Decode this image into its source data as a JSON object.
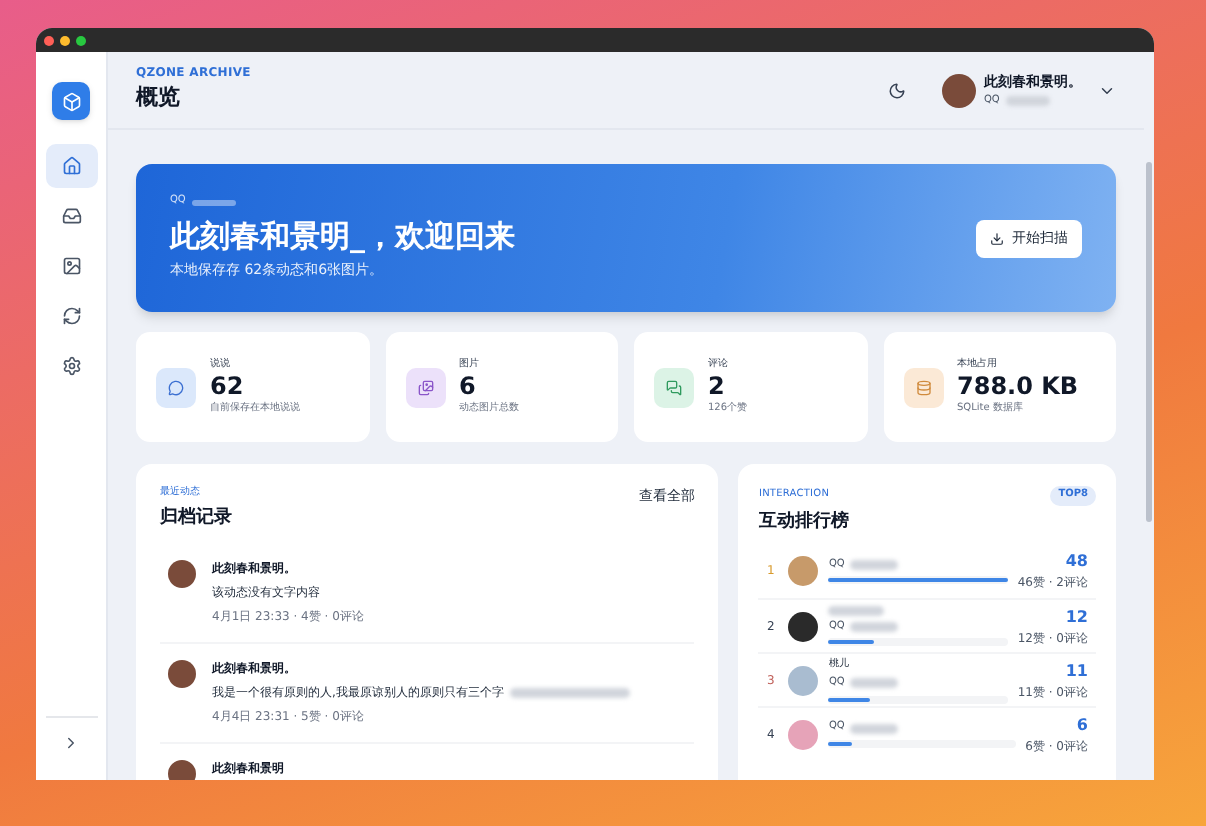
{
  "sidebar": {
    "items": [
      {
        "selected": true
      },
      {
        "selected": false
      },
      {
        "selected": false
      },
      {
        "selected": false
      },
      {
        "selected": false
      }
    ]
  },
  "header": {
    "eyebrow": "QZONE ARCHIVE",
    "title": "概览",
    "user": {
      "name": "此刻春和景明。",
      "qq_label": "QQ"
    }
  },
  "hero": {
    "qq_label": "QQ",
    "title": "此刻春和景明_，欢迎回来",
    "subtitle": "本地保存存 62条动态和6张图片。",
    "button": "开始扫描"
  },
  "stats": [
    {
      "color": "#dbe8fb",
      "label": "说说",
      "value": "62",
      "note": "自前保存在本地说说"
    },
    {
      "color": "#ece1fa",
      "label": "图片",
      "value": "6",
      "note": "动态图片总数"
    },
    {
      "color": "#dcf3e6",
      "label": "评论",
      "value": "2",
      "note": "126个赞"
    },
    {
      "color": "#fbe9d6",
      "label": "本地占用",
      "value": "788.0 KB",
      "note": "SQLite 数据库"
    }
  ],
  "feed": {
    "eyebrow": "最近动态",
    "title": "归档记录",
    "link": "查看全部",
    "items": [
      {
        "name": "此刻春和景明。",
        "text": "该动态没有文字内容",
        "meta": "4月1日 23:33 · 4赞 · 0评论"
      },
      {
        "name": "此刻春和景明。",
        "text": "我是一个很有原则的人,我最原谅别人的原则只有三个字",
        "meta": "4月4日 23:31 · 5赞 · 0评论"
      },
      {
        "name": "此刻春和景明"
      }
    ]
  },
  "ranking": {
    "eyebrow": "INTERACTION",
    "badge": "TOP8",
    "title": "互动排行榜",
    "rows": [
      {
        "rank": "1",
        "qq_label": "QQ",
        "score": "48",
        "detail": "46赞 · 2评论",
        "level": 1.0
      },
      {
        "rank": "2",
        "qq_label": "QQ",
        "score": "12",
        "detail": "12赞 · 0评论",
        "level": 0.25
      },
      {
        "rank": "3",
        "name": "桃儿",
        "qq_label": "QQ",
        "score": "11",
        "detail": "11赞 · 0评论",
        "level": 0.23
      },
      {
        "rank": "4",
        "qq_label": "QQ",
        "score": "6",
        "detail": "6赞 · 0评论",
        "level": 0.125
      }
    ]
  }
}
